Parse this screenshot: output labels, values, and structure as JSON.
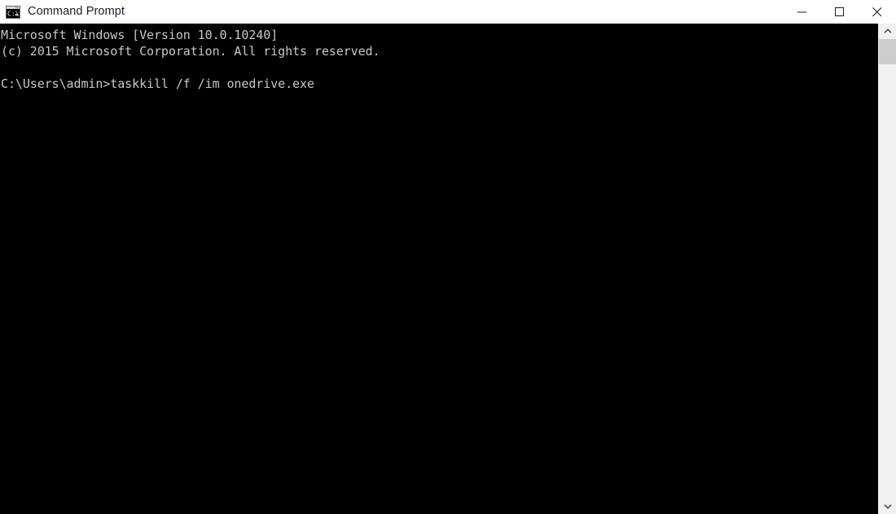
{
  "window": {
    "title": "Command Prompt",
    "icon": "command-prompt-icon",
    "colors": {
      "titlebar_bg": "#ffffff",
      "title_text": "#1a1a2e",
      "console_bg": "#000000",
      "console_text": "#c8c8c8",
      "scrollbar_track": "#f0f0f0",
      "scrollbar_thumb": "#cdcdcd"
    }
  },
  "titlebar": {
    "buttons": [
      {
        "name": "minimize",
        "glyph": "minimize-icon",
        "label": "Minimize"
      },
      {
        "name": "maximize",
        "glyph": "maximize-icon",
        "label": "Maximize"
      },
      {
        "name": "close",
        "glyph": "close-icon",
        "label": "Close"
      }
    ]
  },
  "console": {
    "lines": [
      "Microsoft Windows [Version 10.0.10240]",
      "(c) 2015 Microsoft Corporation. All rights reserved.",
      "",
      "C:\\Users\\admin>taskkill /f /im onedrive.exe"
    ],
    "text": "Microsoft Windows [Version 10.0.10240]\n(c) 2015 Microsoft Corporation. All rights reserved.\n\nC:\\Users\\admin>taskkill /f /im onedrive.exe",
    "version_line": "Microsoft Windows [Version 10.0.10240]",
    "copyright_line": "(c) 2015 Microsoft Corporation. All rights reserved.",
    "prompt": "C:\\Users\\admin>",
    "command": "taskkill /f /im onedrive.exe"
  },
  "scrollbar": {
    "up_arrow": "chevron-up-icon",
    "down_arrow": "chevron-down-icon",
    "thumb": "scrollbar-thumb"
  }
}
